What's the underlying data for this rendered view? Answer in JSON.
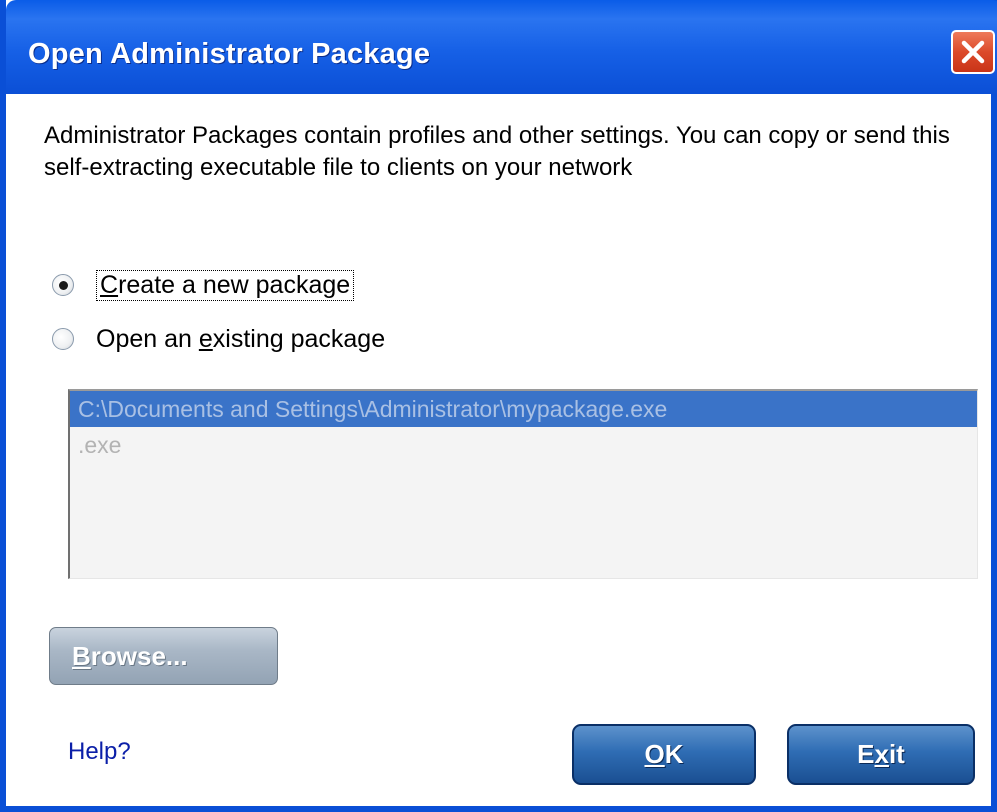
{
  "window": {
    "title": "Open Administrator Package"
  },
  "description": "Administrator Packages contain profiles and other settings. You can copy or send this self-extracting executable file to clients on your network",
  "options": {
    "create_new": {
      "label_prefix": "",
      "label_mnemonic": "C",
      "label_rest": "reate a new package",
      "selected": true
    },
    "open_existing": {
      "label_prefix": "Open an ",
      "label_mnemonic": "e",
      "label_rest": "xisting package",
      "selected": false
    }
  },
  "file_list": {
    "items": [
      "C:\\Documents and Settings\\Administrator\\mypackage.exe",
      ".exe"
    ],
    "selected_index": 0
  },
  "buttons": {
    "browse": {
      "mnemonic": "B",
      "rest": "rowse..."
    },
    "ok": {
      "mnemonic": "O",
      "rest": "K"
    },
    "exit": {
      "prefix": "E",
      "mnemonic": "x",
      "rest": "it"
    }
  },
  "help": {
    "label": "Help?"
  },
  "colors": {
    "title_bar": "#0b4fd6",
    "close_button": "#dc4a2a",
    "selection": "#3a73c8",
    "help_link": "#0b1fa8",
    "action_button": "#2f6db4"
  },
  "icons": {
    "close": "close-x-icon"
  }
}
